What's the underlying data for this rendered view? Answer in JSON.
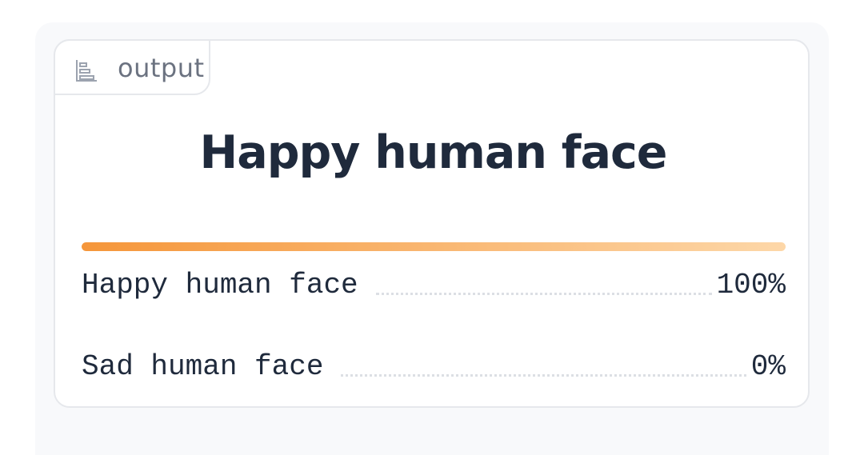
{
  "panel": {
    "tab_label": "output",
    "tab_icon": "bar-chart-icon"
  },
  "result": {
    "top_label": "Happy human face",
    "top_confidence": 1.0,
    "bar_colors": [
      "#f5963a",
      "#fdd7a8"
    ]
  },
  "classes": [
    {
      "label": "Happy human face",
      "value": "100%"
    },
    {
      "label": "Sad human face",
      "value": "0%"
    }
  ]
}
